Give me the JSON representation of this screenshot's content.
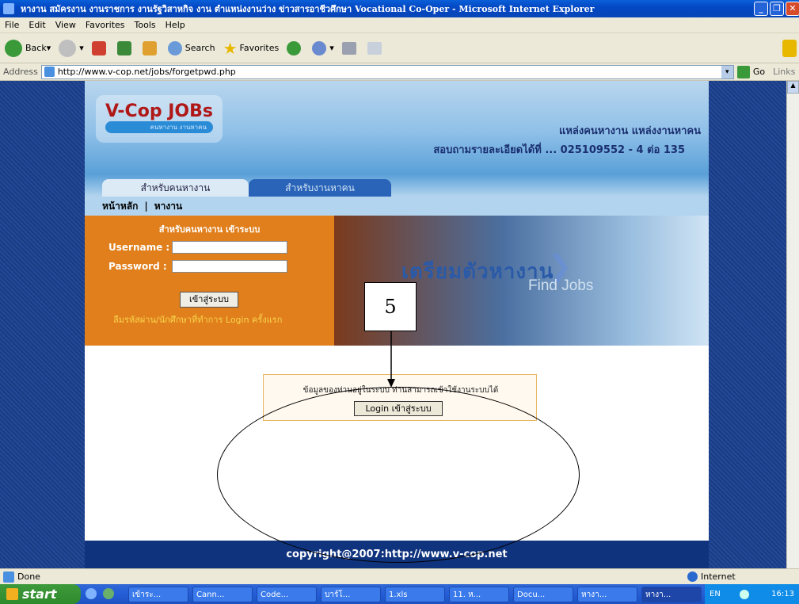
{
  "window": {
    "title": "หางาน สมัครงาน งานราชการ งานรัฐวิสาหกิจ งาน ตำแหน่งงานว่าง ข่าวสารอาชีวศึกษา Vocational Co-Oper - Microsoft Internet Explorer"
  },
  "menu": [
    "File",
    "Edit",
    "View",
    "Favorites",
    "Tools",
    "Help"
  ],
  "toolbar": {
    "back": "Back",
    "search": "Search",
    "favorites": "Favorites"
  },
  "address": {
    "label": "Address",
    "url": "http://www.v-cop.net/jobs/forgetpwd.php",
    "go": "Go",
    "links": "Links"
  },
  "site": {
    "logo_title": "V-Cop JOBs",
    "logo_sub": "คนหางาน งานหาคน",
    "header_line1": "แหล่งคนหางาน แหล่งงานหาคน",
    "header_line2": "สอบถามรายละเอียดได้ที่ ... 025109552 - 4 ต่อ 135",
    "tab_jobseeker": "สำหรับคนหางาน",
    "tab_employer": "สำหรับงานหาคน",
    "nav_home": "หน้าหลัก",
    "nav_sep": "|",
    "nav_jobs": "หางาน",
    "login_title": "สำหรับคนหางาน เข้าระบบ",
    "username_label": "Username :",
    "password_label": "Password :",
    "login_button": "เข้าสู่ระบบ",
    "forgot_link": "ลืมรหัสผ่าน/นักศึกษาที่ทำการ Login ครั้งแรก",
    "banner_title": "เตรียมตัวหางาน",
    "banner_sub": "Find Jobs",
    "message": "ข้อมูลของท่านอยู่ในระบบ ท่านสามารถเข้าใช้งานระบบได้",
    "message_button": "Login เข้าสู่ระบบ",
    "footer": "copyright@2007:http://www.v-cop.net"
  },
  "annotation": {
    "callout": "5"
  },
  "status": {
    "left": "Done",
    "zone": "Internet"
  },
  "taskbar": {
    "start": "start",
    "tasks": [
      "เข้าระ...",
      "Cann...",
      "Code...",
      "บาร์โ...",
      "1.xls",
      "11. ห...",
      "Docu...",
      "หางา...",
      "หางา..."
    ],
    "lang": "EN",
    "clock": "16:13"
  },
  "colors": {
    "orange": "#e07f1c",
    "navy": "#10337e",
    "ie_blue": "#0a5fd8"
  }
}
